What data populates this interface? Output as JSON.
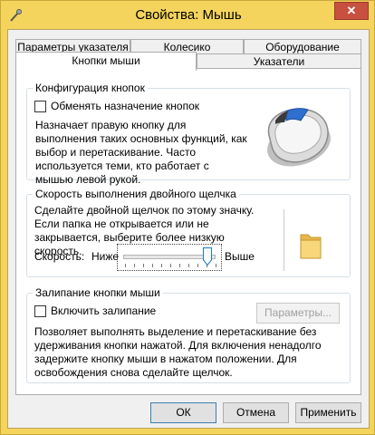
{
  "window": {
    "title": "Свойства: Мышь",
    "close_glyph": "✕"
  },
  "tabs": {
    "row1": [
      "Параметры указателя",
      "Колесико",
      "Оборудование"
    ],
    "row2": [
      "Кнопки мыши",
      "Указатели"
    ],
    "active": "Кнопки мыши"
  },
  "button_config": {
    "title": "Конфигурация кнопок",
    "checkbox_label": "Обменять назначение кнопок",
    "checkbox_checked": false,
    "description": "Назначает правую кнопку для выполнения таких основных функций, как выбор и перетаскивание. Часто используется теми, кто работает с мышью левой рукой."
  },
  "double_click": {
    "title": "Скорость выполнения двойного щелчка",
    "description": "Сделайте двойной щелчок по этому значку. Если папка не открывается или не закрывается, выберите более низкую скорость.",
    "speed_label": "Скорость:",
    "slow_label": "Ниже",
    "fast_label": "Выше",
    "speed_fraction": 0.91
  },
  "click_lock": {
    "title": "Залипание кнопки мыши",
    "checkbox_label": "Включить залипание",
    "checkbox_checked": false,
    "settings_button": "Параметры...",
    "description": "Позволяет выполнять выделение и перетаскивание без удерживания кнопки нажатой. Для включения ненадолго задержите кнопку мыши в нажатом положении. Для освобождения снова сделайте щелчок."
  },
  "footer": {
    "ok": "ОК",
    "cancel": "Отмена",
    "apply": "Применить"
  }
}
